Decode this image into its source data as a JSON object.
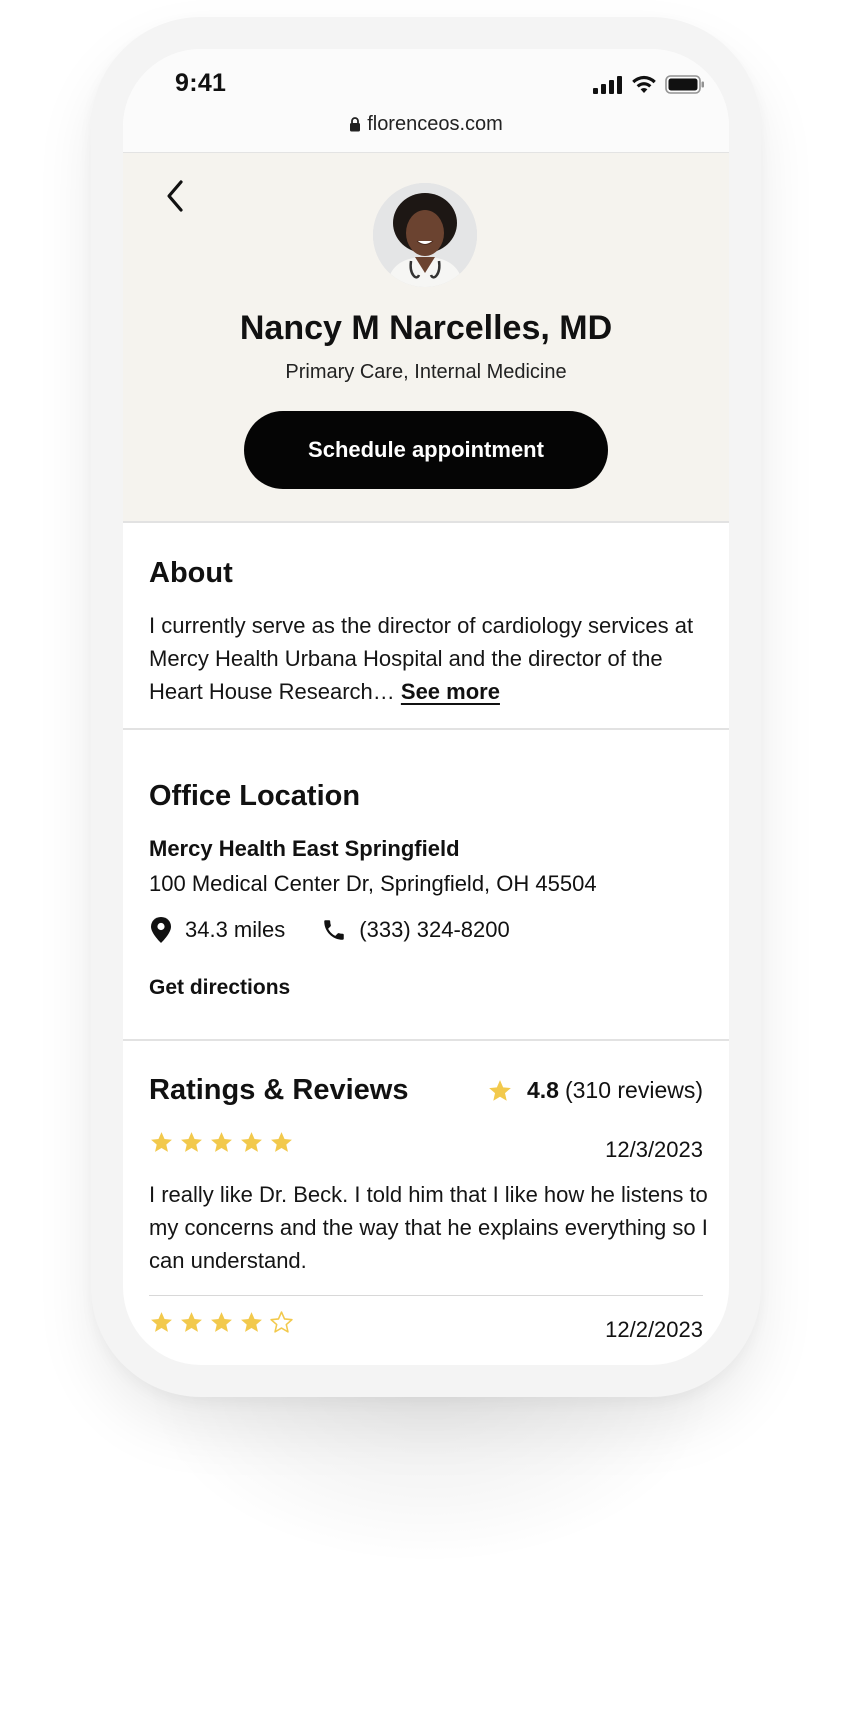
{
  "status_bar": {
    "time": "9:41"
  },
  "browser": {
    "url": "florenceos.com"
  },
  "doctor": {
    "name": "Nancy M Narcelles, MD",
    "specialties": "Primary Care, Internal Medicine",
    "schedule_label": "Schedule appointment"
  },
  "about": {
    "title": "About",
    "text": "I currently serve as the director of cardiology services at Mercy Health Urbana Hospital and the director of the Heart House Research… ",
    "see_more_label": "See more"
  },
  "office": {
    "title": "Office Location",
    "name": "Mercy Health East Springfield",
    "address": "100 Medical Center Dr, Springfield, OH 45504",
    "distance": "34.3 miles",
    "phone": "(333) 324-8200",
    "directions_label": "Get directions"
  },
  "ratings": {
    "title": "Ratings & Reviews",
    "average": "4.8",
    "count": "(310 reviews)",
    "reviews": [
      {
        "stars": 5,
        "date": "12/3/2023",
        "text": "I really like Dr. Beck. I told him that I like how he listens to my concerns and the way that he explains everything so I can understand."
      },
      {
        "stars": 4,
        "date": "12/2/2023"
      }
    ]
  },
  "colors": {
    "star": "#F2C94C",
    "hero_bg": "#F5F3EE",
    "button": "#050505"
  },
  "icons": [
    "lock-icon",
    "back-chevron-icon",
    "location-pin-icon",
    "phone-icon",
    "star-icon",
    "signal-icon",
    "wifi-icon",
    "battery-icon"
  ]
}
